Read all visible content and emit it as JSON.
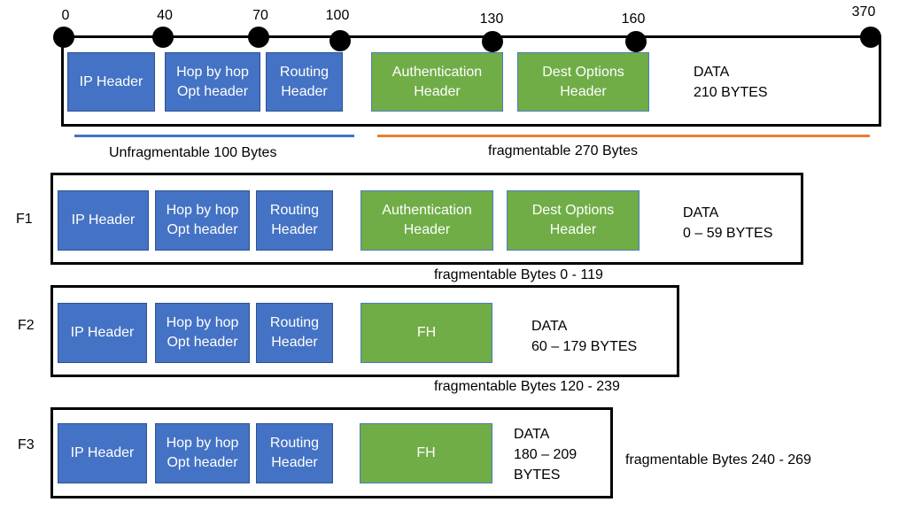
{
  "colors": {
    "unfragmentable": "#4472C4",
    "fragmentable": "#70AD47",
    "fragmentable_range": "#ED7D31"
  },
  "original": {
    "offsets": [
      "0",
      "40",
      "70",
      "100",
      "130",
      "160",
      "370"
    ],
    "blocks": {
      "ip": "IP Header",
      "hop_l1": "Hop by hop",
      "hop_l2": "Opt header",
      "routing_l1": "Routing",
      "routing_l2": "Header",
      "auth_l1": "Authentication",
      "auth_l2": "Header",
      "dest_l1": "Dest Options",
      "dest_l2": "Header"
    },
    "data_l1": "DATA",
    "data_l2": "210 BYTES",
    "unfragmentable_label": "Unfragmentable 100 Bytes",
    "fragmentable_label": "fragmentable 270 Bytes"
  },
  "fragments": [
    {
      "label": "F1",
      "data_l1": "DATA",
      "data_l2": "0 – 59 BYTES",
      "range": "fragmentable Bytes 0 - 119"
    },
    {
      "label": "F2",
      "fh": "FH",
      "data_l1": "DATA",
      "data_l2": "60 – 179 BYTES",
      "range": "fragmentable Bytes 120 - 239"
    },
    {
      "label": "F3",
      "fh": "FH",
      "data_l1": "DATA",
      "data_l2": "180 – 209",
      "data_l3": "BYTES",
      "range": "fragmentable Bytes 240 - 269"
    }
  ]
}
